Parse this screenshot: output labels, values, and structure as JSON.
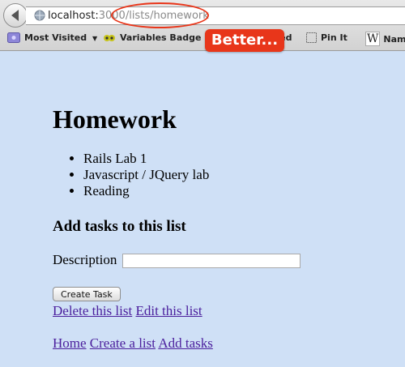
{
  "browser": {
    "url_host": "localhost:",
    "url_port": "3000",
    "url_path": "/lists/homework",
    "bookmarks": {
      "most_visited": "Most Visited",
      "variables_badge": "Variables Badge",
      "started_partial": "arted",
      "pin_it": "Pin It",
      "wiki_partial": "Nam"
    },
    "callout": "Better..."
  },
  "page": {
    "title": "Homework",
    "tasks": [
      "Rails Lab 1",
      "Javascript / JQuery lab",
      "Reading"
    ],
    "add_heading": "Add tasks to this list",
    "description_label": "Description",
    "description_value": "",
    "create_task_label": "Create Task",
    "delete_list": "Delete this list",
    "edit_list": "Edit this list",
    "nav": {
      "home": "Home",
      "create_list": "Create a list",
      "add_tasks": "Add tasks"
    }
  },
  "colors": {
    "callout": "#e8361a",
    "page_bg": "#cfe0f6",
    "link": "#4b1f9d"
  }
}
